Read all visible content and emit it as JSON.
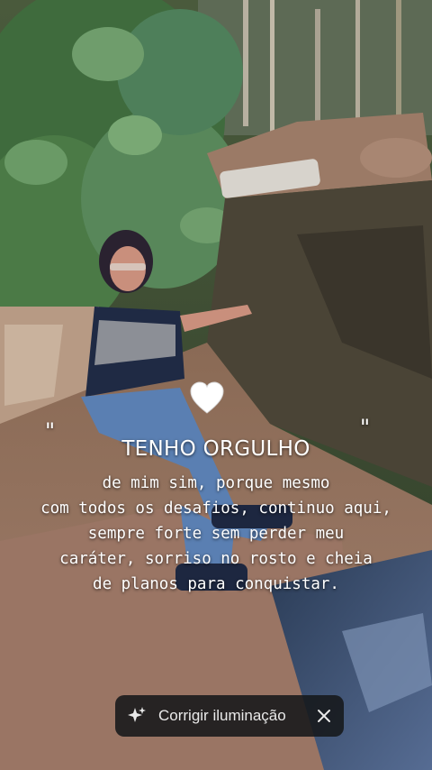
{
  "story": {
    "quote_open": "\"",
    "quote_close": "\"",
    "heart_icon": "white-heart",
    "title": "TENHO ORGULHO",
    "lines": [
      "de mim sim, porque mesmo",
      "com todos os desafios, continuo aqui,",
      "sempre forte sem perder meu",
      "caráter, sorriso no rosto  e cheia",
      "de planos para conquistar."
    ]
  },
  "action_chip": {
    "label": "Corrigir iluminação",
    "icon": "sparkle-icon",
    "close_icon": "close-icon"
  },
  "colors": {
    "text": "#ffffff",
    "chip_bg": "#16181a",
    "chip_text": "#e9e9e9"
  }
}
